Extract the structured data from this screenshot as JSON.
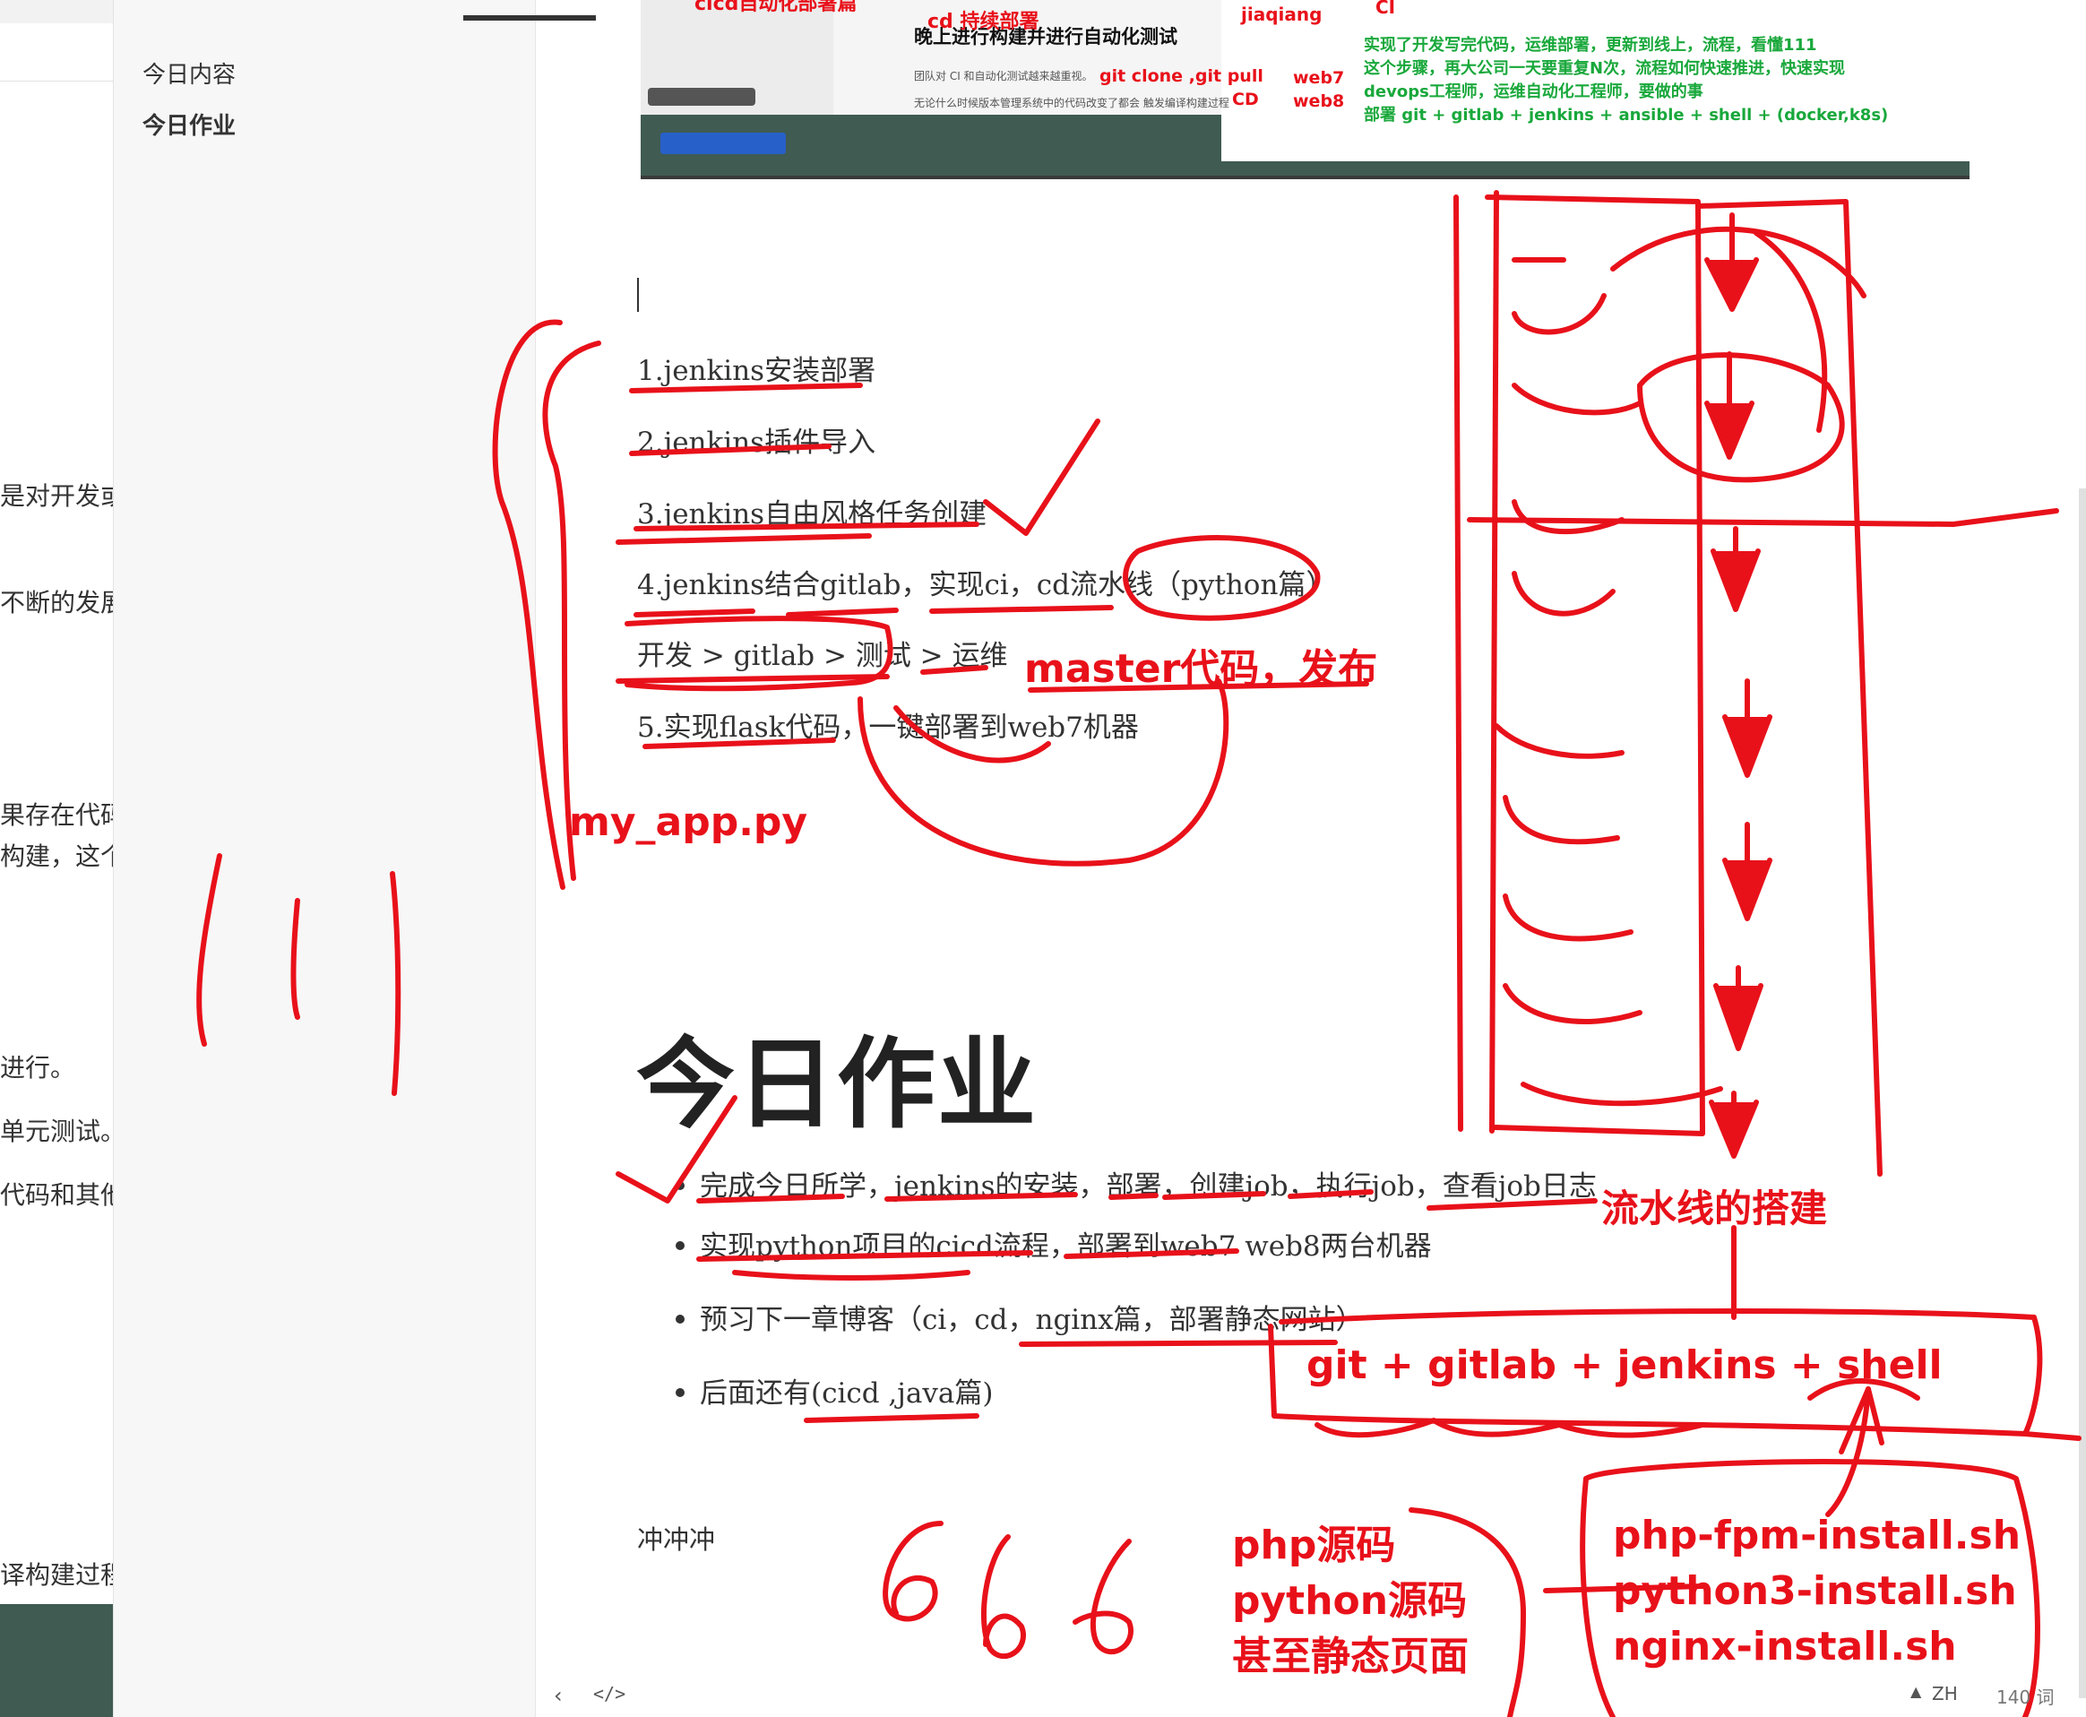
{
  "left_strip": {
    "fragments": [
      "是对开发或",
      "不断的发展",
      "果存在代码",
      "构建，这个",
      "进行。",
      "单元测试。",
      "代码和其他",
      "译构建过程"
    ]
  },
  "outline": {
    "items": [
      "今日内容",
      "今日作业"
    ]
  },
  "embedded_screenshot": {
    "title": "晚上进行构建并进行自动化测试",
    "lines": [
      "团队对 CI 和自动化测试越来越重视。",
      "无论什么时候版本管理系统中的代码改变了都会 触发编译构建过程"
    ],
    "red_notes": [
      "cicd自动化部署篇",
      "cd  持续部署",
      "jiaqiang",
      "CI",
      "git clone ,git pull",
      "web7",
      "web8",
      "CD"
    ],
    "green_notes": [
      "实现了开发写完代码，运维部署，更新到线上，流程，看懂111",
      "这个步骤，再大公司一天要重复N次，流程如何快速推进，快速实现",
      "devops工程师，运维自动化工程师，要做的事",
      "部署 git + gitlab + jenkins + ansible + shell + (docker,k8s)"
    ]
  },
  "content": {
    "steps": [
      "1.jenkins安装部署",
      "2.jenkins插件导入",
      "3.jenkins自由风格任务创建",
      "4.jenkins结合gitlab，实现ci，cd流水线（python篇）",
      "开发 > gitlab > 测试 > 运维",
      "5.实现flask代码，一键部署到web7机器"
    ],
    "heading": "今日作业",
    "homework": [
      "完成今日所学，jenkins的安装，部署，创建job，执行job，查看job日志",
      "实现python项目的cicd流程，部署到web7 web8两台机器",
      "预习下一章博客（ci，cd，nginx篇，部署静态网站）",
      "后面还有(cicd ,java篇)"
    ],
    "closing": "冲冲冲"
  },
  "annotations": {
    "master": "master代码，发布",
    "my_app": "my_app.py",
    "pipeline": "流水线的搭建",
    "stack": "git + gitlab + jenkins + shell",
    "sources": [
      "php源码",
      "python源码",
      "甚至静态页面"
    ],
    "scripts": [
      "php-fpm-install.sh",
      "python3-install.sh",
      "nginx-install.sh"
    ],
    "numbers": "666"
  },
  "status_bar": {
    "prev": "‹",
    "source": "</>",
    "lang": "ZH",
    "words": "140 词"
  },
  "colors": {
    "ink_red": "#e8111a",
    "ink_green": "#19a83b",
    "sidebar_bg": "#f7f7f7",
    "dark_green": "#3f5b52"
  }
}
